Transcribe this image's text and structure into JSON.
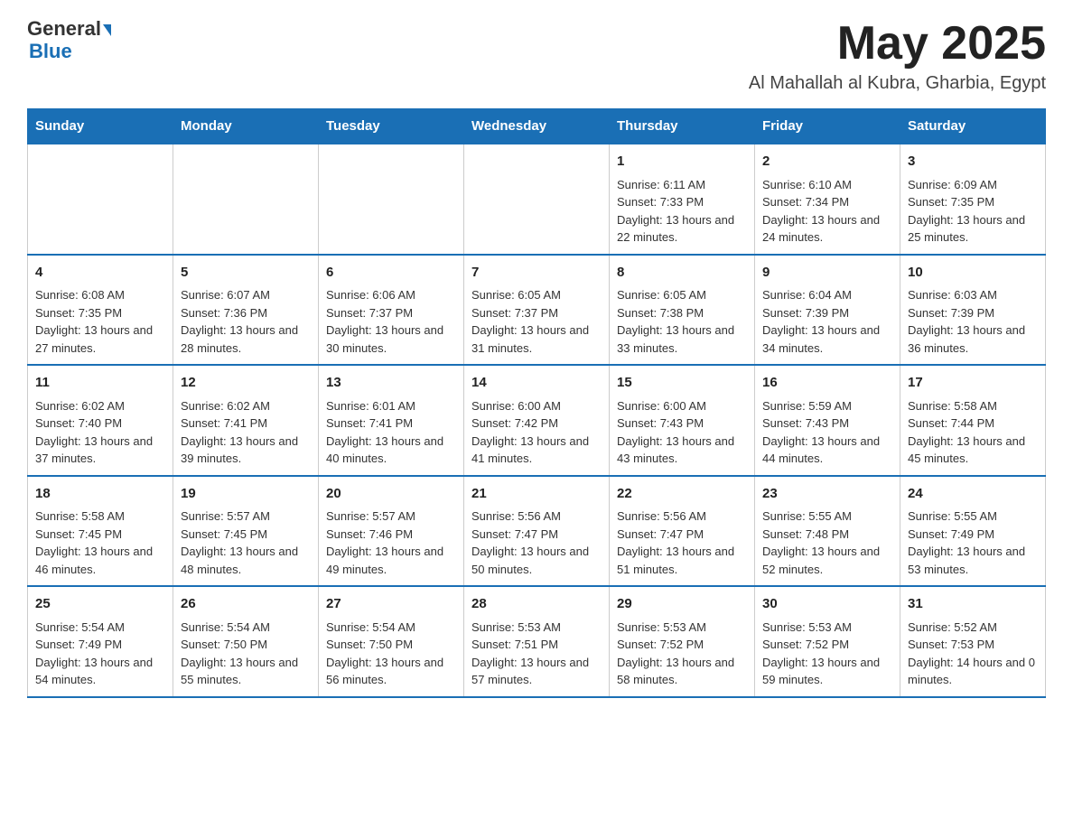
{
  "header": {
    "logo_general": "General",
    "logo_blue": "Blue",
    "title": "May 2025",
    "subtitle": "Al Mahallah al Kubra, Gharbia, Egypt"
  },
  "weekdays": [
    "Sunday",
    "Monday",
    "Tuesday",
    "Wednesday",
    "Thursday",
    "Friday",
    "Saturday"
  ],
  "weeks": [
    [
      {
        "day": "",
        "info": ""
      },
      {
        "day": "",
        "info": ""
      },
      {
        "day": "",
        "info": ""
      },
      {
        "day": "",
        "info": ""
      },
      {
        "day": "1",
        "info": "Sunrise: 6:11 AM\nSunset: 7:33 PM\nDaylight: 13 hours and 22 minutes."
      },
      {
        "day": "2",
        "info": "Sunrise: 6:10 AM\nSunset: 7:34 PM\nDaylight: 13 hours and 24 minutes."
      },
      {
        "day": "3",
        "info": "Sunrise: 6:09 AM\nSunset: 7:35 PM\nDaylight: 13 hours and 25 minutes."
      }
    ],
    [
      {
        "day": "4",
        "info": "Sunrise: 6:08 AM\nSunset: 7:35 PM\nDaylight: 13 hours and 27 minutes."
      },
      {
        "day": "5",
        "info": "Sunrise: 6:07 AM\nSunset: 7:36 PM\nDaylight: 13 hours and 28 minutes."
      },
      {
        "day": "6",
        "info": "Sunrise: 6:06 AM\nSunset: 7:37 PM\nDaylight: 13 hours and 30 minutes."
      },
      {
        "day": "7",
        "info": "Sunrise: 6:05 AM\nSunset: 7:37 PM\nDaylight: 13 hours and 31 minutes."
      },
      {
        "day": "8",
        "info": "Sunrise: 6:05 AM\nSunset: 7:38 PM\nDaylight: 13 hours and 33 minutes."
      },
      {
        "day": "9",
        "info": "Sunrise: 6:04 AM\nSunset: 7:39 PM\nDaylight: 13 hours and 34 minutes."
      },
      {
        "day": "10",
        "info": "Sunrise: 6:03 AM\nSunset: 7:39 PM\nDaylight: 13 hours and 36 minutes."
      }
    ],
    [
      {
        "day": "11",
        "info": "Sunrise: 6:02 AM\nSunset: 7:40 PM\nDaylight: 13 hours and 37 minutes."
      },
      {
        "day": "12",
        "info": "Sunrise: 6:02 AM\nSunset: 7:41 PM\nDaylight: 13 hours and 39 minutes."
      },
      {
        "day": "13",
        "info": "Sunrise: 6:01 AM\nSunset: 7:41 PM\nDaylight: 13 hours and 40 minutes."
      },
      {
        "day": "14",
        "info": "Sunrise: 6:00 AM\nSunset: 7:42 PM\nDaylight: 13 hours and 41 minutes."
      },
      {
        "day": "15",
        "info": "Sunrise: 6:00 AM\nSunset: 7:43 PM\nDaylight: 13 hours and 43 minutes."
      },
      {
        "day": "16",
        "info": "Sunrise: 5:59 AM\nSunset: 7:43 PM\nDaylight: 13 hours and 44 minutes."
      },
      {
        "day": "17",
        "info": "Sunrise: 5:58 AM\nSunset: 7:44 PM\nDaylight: 13 hours and 45 minutes."
      }
    ],
    [
      {
        "day": "18",
        "info": "Sunrise: 5:58 AM\nSunset: 7:45 PM\nDaylight: 13 hours and 46 minutes."
      },
      {
        "day": "19",
        "info": "Sunrise: 5:57 AM\nSunset: 7:45 PM\nDaylight: 13 hours and 48 minutes."
      },
      {
        "day": "20",
        "info": "Sunrise: 5:57 AM\nSunset: 7:46 PM\nDaylight: 13 hours and 49 minutes."
      },
      {
        "day": "21",
        "info": "Sunrise: 5:56 AM\nSunset: 7:47 PM\nDaylight: 13 hours and 50 minutes."
      },
      {
        "day": "22",
        "info": "Sunrise: 5:56 AM\nSunset: 7:47 PM\nDaylight: 13 hours and 51 minutes."
      },
      {
        "day": "23",
        "info": "Sunrise: 5:55 AM\nSunset: 7:48 PM\nDaylight: 13 hours and 52 minutes."
      },
      {
        "day": "24",
        "info": "Sunrise: 5:55 AM\nSunset: 7:49 PM\nDaylight: 13 hours and 53 minutes."
      }
    ],
    [
      {
        "day": "25",
        "info": "Sunrise: 5:54 AM\nSunset: 7:49 PM\nDaylight: 13 hours and 54 minutes."
      },
      {
        "day": "26",
        "info": "Sunrise: 5:54 AM\nSunset: 7:50 PM\nDaylight: 13 hours and 55 minutes."
      },
      {
        "day": "27",
        "info": "Sunrise: 5:54 AM\nSunset: 7:50 PM\nDaylight: 13 hours and 56 minutes."
      },
      {
        "day": "28",
        "info": "Sunrise: 5:53 AM\nSunset: 7:51 PM\nDaylight: 13 hours and 57 minutes."
      },
      {
        "day": "29",
        "info": "Sunrise: 5:53 AM\nSunset: 7:52 PM\nDaylight: 13 hours and 58 minutes."
      },
      {
        "day": "30",
        "info": "Sunrise: 5:53 AM\nSunset: 7:52 PM\nDaylight: 13 hours and 59 minutes."
      },
      {
        "day": "31",
        "info": "Sunrise: 5:52 AM\nSunset: 7:53 PM\nDaylight: 14 hours and 0 minutes."
      }
    ]
  ]
}
